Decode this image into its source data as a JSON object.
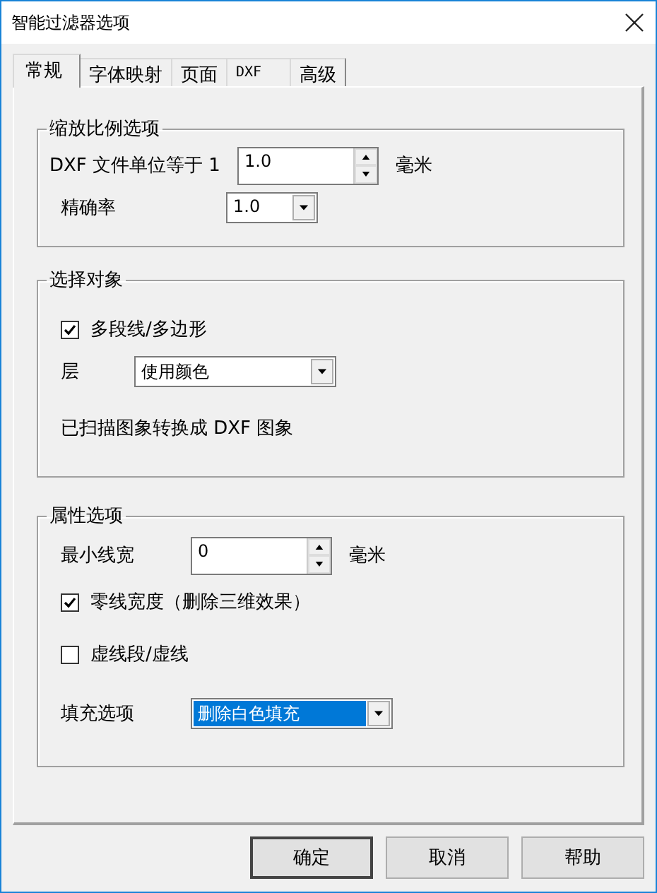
{
  "window": {
    "title": "智能过滤器选项"
  },
  "tabs": [
    {
      "label": "常规",
      "selected": true
    },
    {
      "label": "字体映射",
      "selected": false
    },
    {
      "label": "页面",
      "selected": false
    },
    {
      "label": "DXF",
      "selected": false
    },
    {
      "label": "高级",
      "selected": false
    }
  ],
  "groups": [
    {
      "title": "缩放比例选项",
      "rows": [
        {
          "kind": "spin",
          "label": "DXF 文件单位等于 1",
          "value": "1.0",
          "unit": "毫米"
        },
        {
          "kind": "combo",
          "label": "精确率",
          "value": "1.0",
          "highlighted": false
        }
      ]
    },
    {
      "title": "选择对象",
      "rows": [
        {
          "kind": "checkbox",
          "label": "多段线/多边形",
          "checked": true
        },
        {
          "kind": "combo",
          "label": "层",
          "value": "使用颜色",
          "highlighted": false
        },
        {
          "kind": "note",
          "text": "已扫描图象转换成 DXF 图象"
        }
      ]
    },
    {
      "title": "属性选项",
      "rows": [
        {
          "kind": "spin",
          "label": "最小线宽",
          "value": "0",
          "unit": "毫米"
        },
        {
          "kind": "checkbox",
          "label": "零线宽度（删除三维效果）",
          "checked": true
        },
        {
          "kind": "checkbox",
          "label": "虚线段/虚线",
          "checked": false
        },
        {
          "kind": "combo",
          "label": "填充选项",
          "value": "删除白色填充",
          "highlighted": true
        }
      ]
    }
  ],
  "buttons": [
    {
      "label": "确定",
      "default": true
    },
    {
      "label": "取消",
      "default": false
    },
    {
      "label": "帮助",
      "default": false
    }
  ]
}
